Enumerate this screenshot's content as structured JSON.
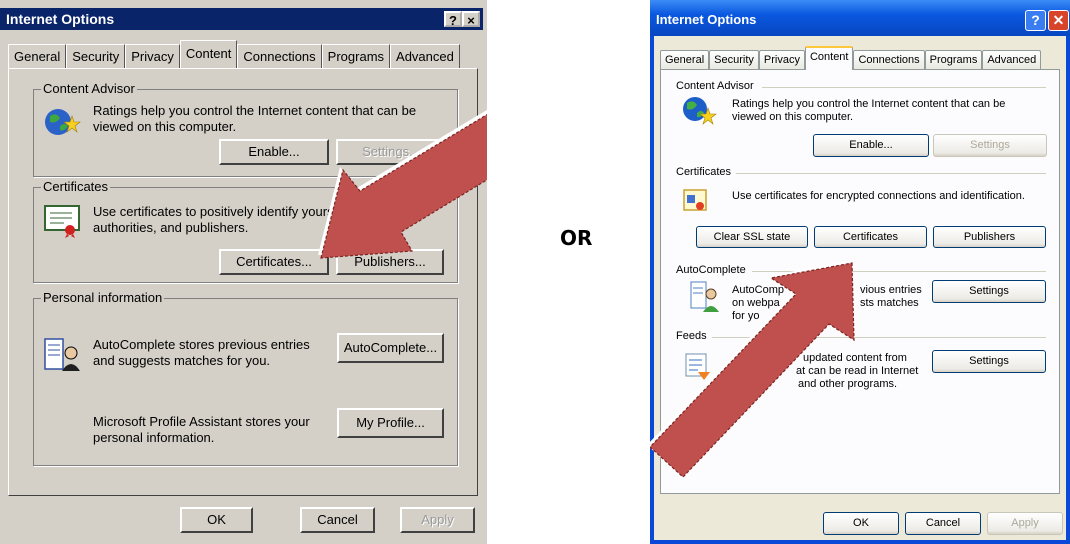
{
  "separator": "OR",
  "classic": {
    "title": "Internet Options",
    "title_btns": [
      "?",
      "×"
    ],
    "tabs": [
      "General",
      "Security",
      "Privacy",
      "Content",
      "Connections",
      "Programs",
      "Advanced"
    ],
    "active_tab": "Content",
    "content_advisor": {
      "label": "Content Advisor",
      "desc_line1": "Ratings help you control the Internet content that can be",
      "desc_line2": "viewed on this computer.",
      "enable": "Enable...",
      "settings": "Settings..."
    },
    "certificates": {
      "label": "Certificates",
      "desc_line1": "Use certificates to positively identify yourself",
      "desc_line2": "authorities, and publishers.",
      "certificates_btn": "Certificates...",
      "publishers_btn": "Publishers..."
    },
    "personal": {
      "label": "Personal information",
      "auto_line1": "AutoComplete stores previous entries",
      "auto_line2": "and suggests matches for you.",
      "autocomplete_btn": "AutoComplete...",
      "profile_line1": "Microsoft Profile Assistant stores your",
      "profile_line2": "personal information.",
      "profile_btn": "My Profile..."
    },
    "buttons": {
      "ok": "OK",
      "cancel": "Cancel",
      "apply": "Apply"
    }
  },
  "xp": {
    "title": "Internet Options",
    "tabs": [
      "General",
      "Security",
      "Privacy",
      "Content",
      "Connections",
      "Programs",
      "Advanced"
    ],
    "content_advisor": {
      "label": "Content Advisor",
      "desc_line1": "Ratings help you control the Internet content that can be",
      "desc_line2": "viewed on this computer.",
      "enable": "Enable...",
      "settings": "Settings"
    },
    "certificates": {
      "label": "Certificates",
      "desc": "Use certificates for encrypted connections and identification.",
      "clear_ssl": "Clear SSL state",
      "certificates_btn": "Certificates",
      "publishers_btn": "Publishers"
    },
    "autocomplete": {
      "label": "AutoComplete",
      "line1a": "AutoComp",
      "line1b": "vious entries",
      "line2a": "on webpa",
      "line2b": "sts matches",
      "line3": "for yo",
      "settings": "Settings"
    },
    "feeds": {
      "label": "Feeds",
      "line1": "updated content from",
      "line2a": "at can be read in Internet",
      "line3": "and other programs.",
      "settings": "Settings"
    },
    "buttons": {
      "ok": "OK",
      "cancel": "Cancel",
      "apply": "Apply"
    }
  },
  "colors": {
    "arrow_fill": "#c0504d",
    "classic_title": "#0a246a",
    "xp_title": "#0a58e0"
  }
}
